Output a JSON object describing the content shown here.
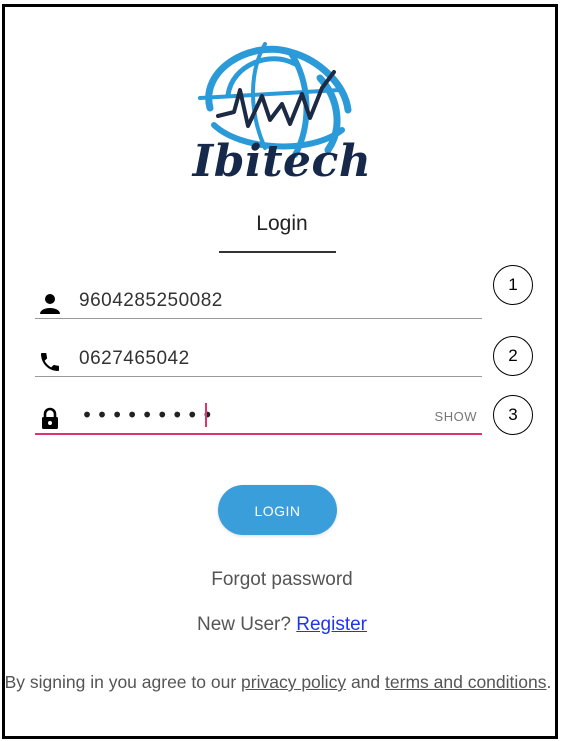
{
  "app": {
    "brand_name": "Ibitech"
  },
  "form": {
    "title": "Login",
    "fields": [
      {
        "icon": "person-icon",
        "value": "9604285250082",
        "marker": "1"
      },
      {
        "icon": "phone-icon",
        "value": "0627465042",
        "marker": "2"
      },
      {
        "icon": "lock-icon",
        "value": "•••••••••",
        "marker": "3",
        "toggle_label": "SHOW"
      }
    ],
    "login_label": "LOGIN",
    "forgot_label": "Forgot password",
    "new_user_text": "New User?",
    "register_label": "Register"
  },
  "footer": {
    "prefix": "By signing in you agree to our",
    "privacy_label": "privacy policy",
    "and_text": "and",
    "terms_label": "terms and conditions",
    "suffix": "."
  },
  "colors": {
    "brand_navy": "#16294a",
    "logo_blue": "#2b9ad8",
    "button_blue": "#3a9edb",
    "active_underline": "#e0336c",
    "link_blue": "#2233ee"
  }
}
